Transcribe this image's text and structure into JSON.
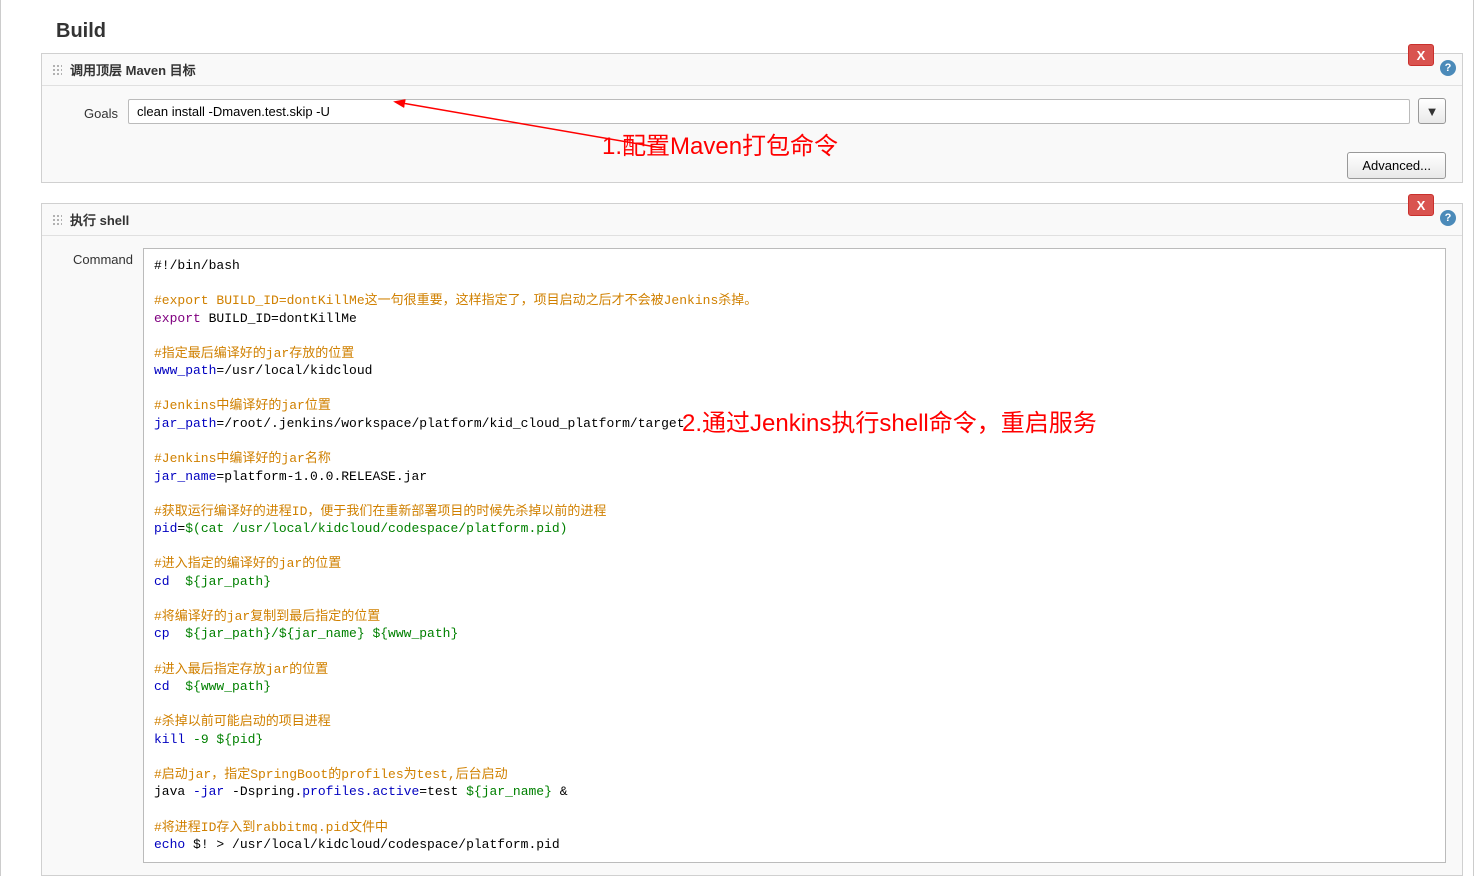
{
  "section_title": "Build",
  "maven_panel": {
    "title": "调用顶层 Maven 目标",
    "goals_label": "Goals",
    "goals_value": "clean install -Dmaven.test.skip -U",
    "advanced_label": "Advanced...",
    "close_label": "X"
  },
  "shell_panel": {
    "title": "执行 shell",
    "command_label": "Command",
    "close_label": "X"
  },
  "shell_script": {
    "line1": "#!/bin/bash",
    "line2_comment": "#export BUILD_ID=dontKillMe这一句很重要，这样指定了，项目启动之后才不会被Jenkins杀掉。",
    "line3_kw": "export",
    "line3_rest": " BUILD_ID=dontKillMe",
    "line4_comment": "#指定最后编译好的jar存放的位置",
    "line5_var": "www_path",
    "line5_rest": "=/usr/local/kidcloud",
    "line6_comment": "#Jenkins中编译好的jar位置",
    "line7_var": "jar_path",
    "line7_rest": "=/root/.jenkins/workspace/platform/kid_cloud_platform/target",
    "line8_comment": "#Jenkins中编译好的jar名称",
    "line9_var": "jar_name",
    "line9_rest": "=platform-1.0.0.RELEASE.jar",
    "line10_comment": "#获取运行编译好的进程ID，便于我们在重新部署项目的时候先杀掉以前的进程",
    "line11_var": "pid",
    "line11_eq": "=",
    "line11_cmd": "$(cat /usr/local/kidcloud/codespace/platform.pid)",
    "line12_comment": "#进入指定的编译好的jar的位置",
    "line13_cmd": "cd",
    "line13_arg": "  ${jar_path}",
    "line14_comment": "#将编译好的jar复制到最后指定的位置",
    "line15_cmd": "cp",
    "line15_arg": "  ${jar_path}/${jar_name} ${www_path}",
    "line16_comment": "#进入最后指定存放jar的位置",
    "line17_cmd": "cd",
    "line17_arg": "  ${www_path}",
    "line18_comment": "#杀掉以前可能启动的项目进程",
    "line19_cmd": "kill",
    "line19_arg": " -9 ${pid}",
    "line20_comment": "#启动jar，指定SpringBoot的profiles为test,后台启动",
    "line21_a": "java ",
    "line21_b": "-jar",
    "line21_c": " -Dspring.",
    "line21_d": "profiles.active",
    "line21_e": "=test ",
    "line21_f": "${jar_name}",
    "line21_g": " &",
    "line22_comment": "#将进程ID存入到rabbitmq.pid文件中",
    "line23_cmd": "echo",
    "line23_arg": " $! > /usr/local/kidcloud/codespace/platform.pid"
  },
  "annotations": {
    "a1": "1.配置Maven打包命令",
    "a2": "2.通过Jenkins执行shell命令，重启服务"
  }
}
